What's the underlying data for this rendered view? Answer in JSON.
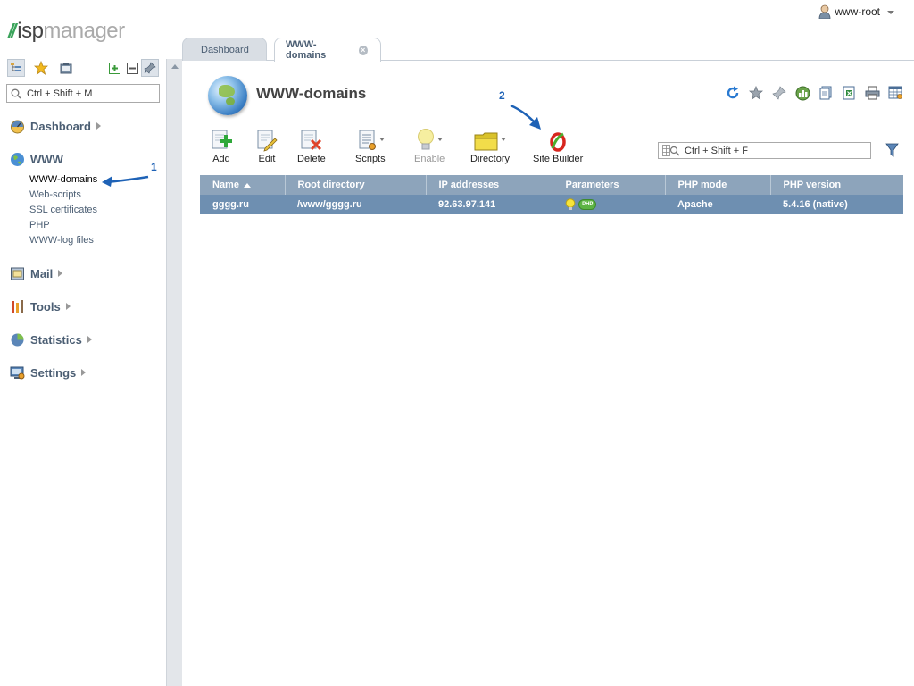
{
  "app": {
    "logo_prefix": "isp",
    "logo_suffix": "manager"
  },
  "user": {
    "name": "www-root"
  },
  "sidebar": {
    "search_placeholder": "Ctrl + Shift + M",
    "groups": [
      {
        "label": "Dashboard",
        "icon": "dashboard-icon"
      },
      {
        "label": "WWW",
        "icon": "www-icon",
        "items": [
          "WWW-domains",
          "Web-scripts",
          "SSL certificates",
          "PHP",
          "WWW-log files"
        ]
      },
      {
        "label": "Mail",
        "icon": "mail-icon"
      },
      {
        "label": "Tools",
        "icon": "tools-icon"
      },
      {
        "label": "Statistics",
        "icon": "statistics-icon"
      },
      {
        "label": "Settings",
        "icon": "settings-icon"
      }
    ]
  },
  "tabs": [
    {
      "label": "Dashboard",
      "active": false
    },
    {
      "label": "WWW-domains",
      "active": true
    }
  ],
  "header": {
    "title": "WWW-domains"
  },
  "toolbar": {
    "add": "Add",
    "edit": "Edit",
    "delete": "Delete",
    "scripts": "Scripts",
    "enable": "Enable",
    "directory": "Directory",
    "site_builder": "Site Builder"
  },
  "filter": {
    "placeholder": "Ctrl + Shift + F"
  },
  "table": {
    "columns": [
      "Name",
      "Root directory",
      "IP addresses",
      "Parameters",
      "PHP mode",
      "PHP version"
    ],
    "rows": [
      {
        "name": "gggg.ru",
        "root": "/www/gggg.ru",
        "ip": "92.63.97.141",
        "php_badge": "PHP",
        "mode": "Apache",
        "version": "5.4.16 (native)"
      }
    ]
  },
  "annotations": {
    "one": "1",
    "two": "2"
  },
  "colors": {
    "accent": "#4b5e73",
    "header_row": "#8da4bb",
    "selected_row": "#6e8fb1",
    "arrow": "#1e62b6"
  }
}
